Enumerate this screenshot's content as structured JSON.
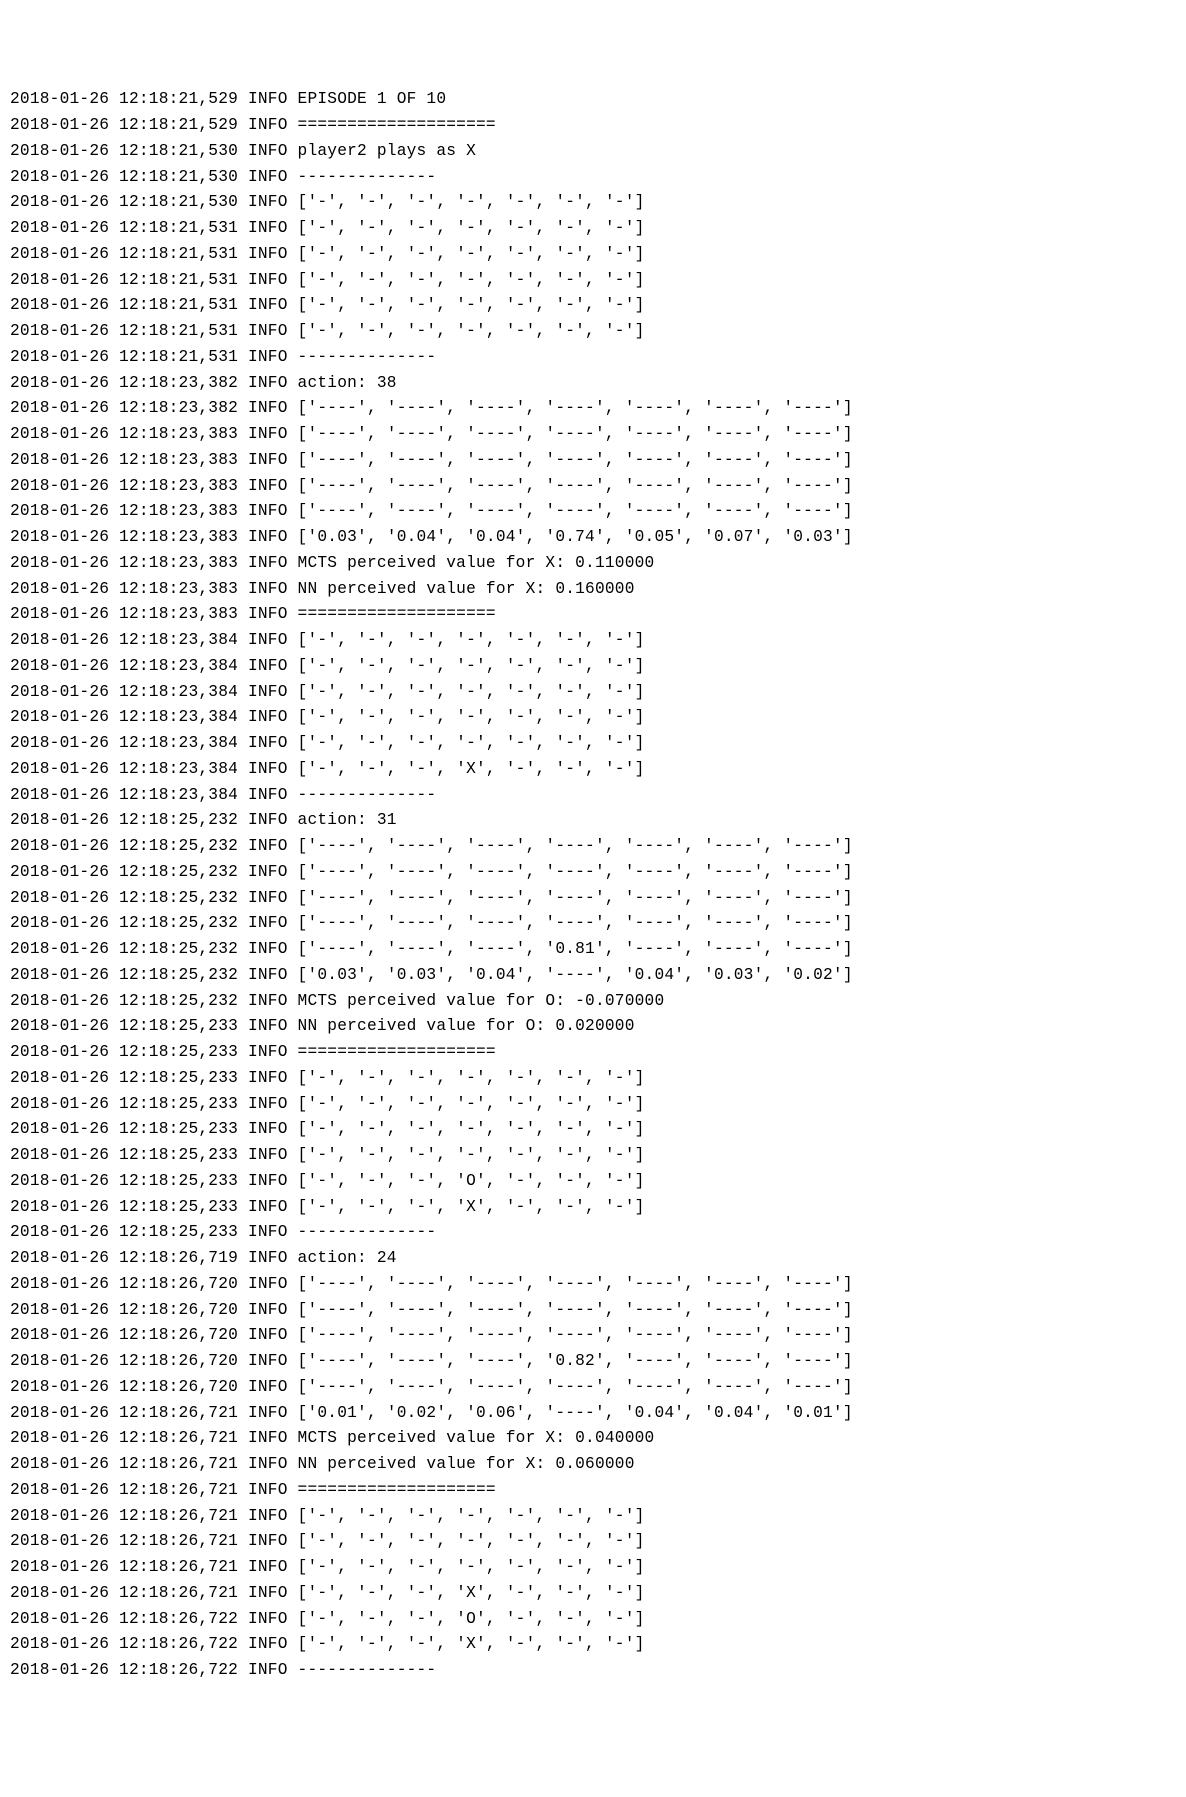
{
  "lines": [
    {
      "ts": "2018-01-26 12:18:21,529",
      "lvl": "INFO",
      "msg": "EPISODE 1 OF 10"
    },
    {
      "ts": "2018-01-26 12:18:21,529",
      "lvl": "INFO",
      "msg": "===================="
    },
    {
      "ts": "2018-01-26 12:18:21,530",
      "lvl": "INFO",
      "msg": "player2 plays as X"
    },
    {
      "ts": "2018-01-26 12:18:21,530",
      "lvl": "INFO",
      "msg": "--------------"
    },
    {
      "ts": "2018-01-26 12:18:21,530",
      "lvl": "INFO",
      "msg": "['-', '-', '-', '-', '-', '-', '-']"
    },
    {
      "ts": "2018-01-26 12:18:21,531",
      "lvl": "INFO",
      "msg": "['-', '-', '-', '-', '-', '-', '-']"
    },
    {
      "ts": "2018-01-26 12:18:21,531",
      "lvl": "INFO",
      "msg": "['-', '-', '-', '-', '-', '-', '-']"
    },
    {
      "ts": "2018-01-26 12:18:21,531",
      "lvl": "INFO",
      "msg": "['-', '-', '-', '-', '-', '-', '-']"
    },
    {
      "ts": "2018-01-26 12:18:21,531",
      "lvl": "INFO",
      "msg": "['-', '-', '-', '-', '-', '-', '-']"
    },
    {
      "ts": "2018-01-26 12:18:21,531",
      "lvl": "INFO",
      "msg": "['-', '-', '-', '-', '-', '-', '-']"
    },
    {
      "ts": "2018-01-26 12:18:21,531",
      "lvl": "INFO",
      "msg": "--------------"
    },
    {
      "ts": "2018-01-26 12:18:23,382",
      "lvl": "INFO",
      "msg": "action: 38"
    },
    {
      "ts": "2018-01-26 12:18:23,382",
      "lvl": "INFO",
      "msg": "['----', '----', '----', '----', '----', '----', '----']"
    },
    {
      "ts": "2018-01-26 12:18:23,383",
      "lvl": "INFO",
      "msg": "['----', '----', '----', '----', '----', '----', '----']"
    },
    {
      "ts": "2018-01-26 12:18:23,383",
      "lvl": "INFO",
      "msg": "['----', '----', '----', '----', '----', '----', '----']"
    },
    {
      "ts": "2018-01-26 12:18:23,383",
      "lvl": "INFO",
      "msg": "['----', '----', '----', '----', '----', '----', '----']"
    },
    {
      "ts": "2018-01-26 12:18:23,383",
      "lvl": "INFO",
      "msg": "['----', '----', '----', '----', '----', '----', '----']"
    },
    {
      "ts": "2018-01-26 12:18:23,383",
      "lvl": "INFO",
      "msg": "['0.03', '0.04', '0.04', '0.74', '0.05', '0.07', '0.03']"
    },
    {
      "ts": "2018-01-26 12:18:23,383",
      "lvl": "INFO",
      "msg": "MCTS perceived value for X: 0.110000"
    },
    {
      "ts": "2018-01-26 12:18:23,383",
      "lvl": "INFO",
      "msg": "NN perceived value for X: 0.160000"
    },
    {
      "ts": "2018-01-26 12:18:23,383",
      "lvl": "INFO",
      "msg": "===================="
    },
    {
      "ts": "2018-01-26 12:18:23,384",
      "lvl": "INFO",
      "msg": "['-', '-', '-', '-', '-', '-', '-']"
    },
    {
      "ts": "2018-01-26 12:18:23,384",
      "lvl": "INFO",
      "msg": "['-', '-', '-', '-', '-', '-', '-']"
    },
    {
      "ts": "2018-01-26 12:18:23,384",
      "lvl": "INFO",
      "msg": "['-', '-', '-', '-', '-', '-', '-']"
    },
    {
      "ts": "2018-01-26 12:18:23,384",
      "lvl": "INFO",
      "msg": "['-', '-', '-', '-', '-', '-', '-']"
    },
    {
      "ts": "2018-01-26 12:18:23,384",
      "lvl": "INFO",
      "msg": "['-', '-', '-', '-', '-', '-', '-']"
    },
    {
      "ts": "2018-01-26 12:18:23,384",
      "lvl": "INFO",
      "msg": "['-', '-', '-', 'X', '-', '-', '-']"
    },
    {
      "ts": "2018-01-26 12:18:23,384",
      "lvl": "INFO",
      "msg": "--------------"
    },
    {
      "ts": "2018-01-26 12:18:25,232",
      "lvl": "INFO",
      "msg": "action: 31"
    },
    {
      "ts": "2018-01-26 12:18:25,232",
      "lvl": "INFO",
      "msg": "['----', '----', '----', '----', '----', '----', '----']"
    },
    {
      "ts": "2018-01-26 12:18:25,232",
      "lvl": "INFO",
      "msg": "['----', '----', '----', '----', '----', '----', '----']"
    },
    {
      "ts": "2018-01-26 12:18:25,232",
      "lvl": "INFO",
      "msg": "['----', '----', '----', '----', '----', '----', '----']"
    },
    {
      "ts": "2018-01-26 12:18:25,232",
      "lvl": "INFO",
      "msg": "['----', '----', '----', '----', '----', '----', '----']"
    },
    {
      "ts": "2018-01-26 12:18:25,232",
      "lvl": "INFO",
      "msg": "['----', '----', '----', '0.81', '----', '----', '----']"
    },
    {
      "ts": "2018-01-26 12:18:25,232",
      "lvl": "INFO",
      "msg": "['0.03', '0.03', '0.04', '----', '0.04', '0.03', '0.02']"
    },
    {
      "ts": "2018-01-26 12:18:25,232",
      "lvl": "INFO",
      "msg": "MCTS perceived value for O: -0.070000"
    },
    {
      "ts": "2018-01-26 12:18:25,233",
      "lvl": "INFO",
      "msg": "NN perceived value for O: 0.020000"
    },
    {
      "ts": "2018-01-26 12:18:25,233",
      "lvl": "INFO",
      "msg": "===================="
    },
    {
      "ts": "2018-01-26 12:18:25,233",
      "lvl": "INFO",
      "msg": "['-', '-', '-', '-', '-', '-', '-']"
    },
    {
      "ts": "2018-01-26 12:18:25,233",
      "lvl": "INFO",
      "msg": "['-', '-', '-', '-', '-', '-', '-']"
    },
    {
      "ts": "2018-01-26 12:18:25,233",
      "lvl": "INFO",
      "msg": "['-', '-', '-', '-', '-', '-', '-']"
    },
    {
      "ts": "2018-01-26 12:18:25,233",
      "lvl": "INFO",
      "msg": "['-', '-', '-', '-', '-', '-', '-']"
    },
    {
      "ts": "2018-01-26 12:18:25,233",
      "lvl": "INFO",
      "msg": "['-', '-', '-', 'O', '-', '-', '-']"
    },
    {
      "ts": "2018-01-26 12:18:25,233",
      "lvl": "INFO",
      "msg": "['-', '-', '-', 'X', '-', '-', '-']"
    },
    {
      "ts": "2018-01-26 12:18:25,233",
      "lvl": "INFO",
      "msg": "--------------"
    },
    {
      "ts": "2018-01-26 12:18:26,719",
      "lvl": "INFO",
      "msg": "action: 24"
    },
    {
      "ts": "2018-01-26 12:18:26,720",
      "lvl": "INFO",
      "msg": "['----', '----', '----', '----', '----', '----', '----']"
    },
    {
      "ts": "2018-01-26 12:18:26,720",
      "lvl": "INFO",
      "msg": "['----', '----', '----', '----', '----', '----', '----']"
    },
    {
      "ts": "2018-01-26 12:18:26,720",
      "lvl": "INFO",
      "msg": "['----', '----', '----', '----', '----', '----', '----']"
    },
    {
      "ts": "2018-01-26 12:18:26,720",
      "lvl": "INFO",
      "msg": "['----', '----', '----', '0.82', '----', '----', '----']"
    },
    {
      "ts": "2018-01-26 12:18:26,720",
      "lvl": "INFO",
      "msg": "['----', '----', '----', '----', '----', '----', '----']"
    },
    {
      "ts": "2018-01-26 12:18:26,721",
      "lvl": "INFO",
      "msg": "['0.01', '0.02', '0.06', '----', '0.04', '0.04', '0.01']"
    },
    {
      "ts": "2018-01-26 12:18:26,721",
      "lvl": "INFO",
      "msg": "MCTS perceived value for X: 0.040000"
    },
    {
      "ts": "2018-01-26 12:18:26,721",
      "lvl": "INFO",
      "msg": "NN perceived value for X: 0.060000"
    },
    {
      "ts": "2018-01-26 12:18:26,721",
      "lvl": "INFO",
      "msg": "===================="
    },
    {
      "ts": "2018-01-26 12:18:26,721",
      "lvl": "INFO",
      "msg": "['-', '-', '-', '-', '-', '-', '-']"
    },
    {
      "ts": "2018-01-26 12:18:26,721",
      "lvl": "INFO",
      "msg": "['-', '-', '-', '-', '-', '-', '-']"
    },
    {
      "ts": "2018-01-26 12:18:26,721",
      "lvl": "INFO",
      "msg": "['-', '-', '-', '-', '-', '-', '-']"
    },
    {
      "ts": "2018-01-26 12:18:26,721",
      "lvl": "INFO",
      "msg": "['-', '-', '-', 'X', '-', '-', '-']"
    },
    {
      "ts": "2018-01-26 12:18:26,722",
      "lvl": "INFO",
      "msg": "['-', '-', '-', 'O', '-', '-', '-']"
    },
    {
      "ts": "2018-01-26 12:18:26,722",
      "lvl": "INFO",
      "msg": "['-', '-', '-', 'X', '-', '-', '-']"
    },
    {
      "ts": "2018-01-26 12:18:26,722",
      "lvl": "INFO",
      "msg": "--------------"
    }
  ]
}
